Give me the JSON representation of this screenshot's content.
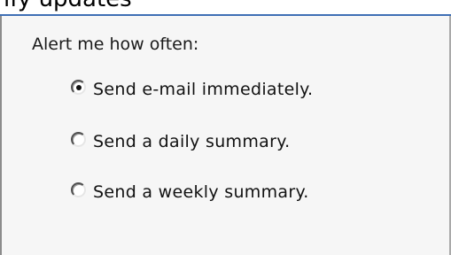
{
  "header": {
    "cropped_text": "ify updates"
  },
  "alert_settings": {
    "question": "Alert me how often:",
    "options": [
      {
        "label": "Send e-mail immediately.",
        "checked": true
      },
      {
        "label": "Send a daily summary.",
        "checked": false
      },
      {
        "label": "Send a weekly summary.",
        "checked": false
      }
    ]
  },
  "colors": {
    "accent_rule": "#3f6fb5",
    "panel_background": "#f6f6f6"
  }
}
